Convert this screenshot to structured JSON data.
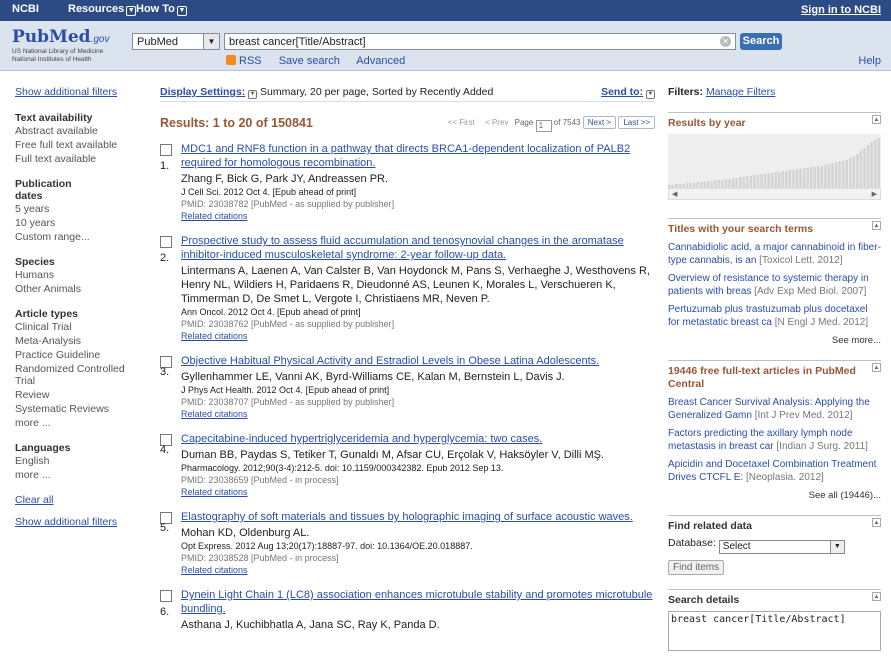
{
  "topbar": {
    "ncbi": "NCBI",
    "resources": "Resources",
    "howto": "How To",
    "signin": "Sign in to NCBI"
  },
  "logo": {
    "pub": "PubMed",
    "gov": ".gov",
    "nlm1": "US National Library of Medicine",
    "nlm2": "National Institutes of Health"
  },
  "search": {
    "db": "PubMed",
    "query": "breast cancer[Title/Abstract]",
    "button": "Search",
    "rss": "RSS",
    "save": "Save search",
    "advanced": "Advanced",
    "help": "Help"
  },
  "left": {
    "show_filters": "Show additional filters",
    "text_availability": "Text availability",
    "ta_items": [
      "Abstract available",
      "Free full text available",
      "Full text available"
    ],
    "pub_dates": "Publication dates",
    "pd_items": [
      "5 years",
      "10 years",
      "Custom range..."
    ],
    "species": "Species",
    "sp_items": [
      "Humans",
      "Other Animals"
    ],
    "article_types": "Article types",
    "at_items": [
      "Clinical Trial",
      "Meta-Analysis",
      "Practice Guideline",
      "Randomized Controlled Trial",
      "Review",
      "Systematic Reviews",
      "more ..."
    ],
    "languages": "Languages",
    "lang_items": [
      "English",
      "more ..."
    ],
    "clear_all": "Clear all",
    "show_filters2": "Show additional filters"
  },
  "display": {
    "label": "Display Settings:",
    "summary": "Summary, 20 per page, Sorted by Recently Added",
    "sendto": "Send to:"
  },
  "results": {
    "count": "Results: 1 to 20 of 150841",
    "pager": {
      "first": "<< First",
      "prev": "< Prev",
      "page_label": "Page",
      "page": "1",
      "of": "of 7543",
      "next": "Next >",
      "last": "Last >>"
    },
    "items": [
      {
        "num": "1.",
        "title": "MDC1 and RNF8 function in a pathway that directs BRCA1-dependent localization of PALB2 required for homologous recombination.",
        "authors": "Zhang F, Bick G, Park JY, Andreassen PR.",
        "journal": "J Cell Sci. 2012 Oct 4. [Epub ahead of print]",
        "pmid": "PMID: 23038782 [PubMed - as supplied by publisher]",
        "related": "Related citations"
      },
      {
        "num": "2.",
        "title": "Prospective study to assess fluid accumulation and tenosynovial changes in the aromatase inhibitor-induced musculoskeletal syndrome: 2-year follow-up data.",
        "authors": "Lintermans A, Laenen A, Van Calster B, Van Hoydonck M, Pans S, Verhaeghe J, Westhovens R, Henry NL, Wildiers H, Paridaens R, Dieudonné AS, Leunen K, Morales L, Verschueren K, Timmerman D, De Smet L, Vergote I, Christiaens MR, Neven P.",
        "journal": "Ann Oncol. 2012 Oct 4. [Epub ahead of print]",
        "pmid": "PMID: 23038762 [PubMed - as supplied by publisher]",
        "related": "Related citations"
      },
      {
        "num": "3.",
        "title": "Objective Habitual Physical Activity and Estradiol Levels in Obese Latina Adolescents.",
        "authors": "Gyllenhammer LE, Vanni AK, Byrd-Williams CE, Kalan M, Bernstein L, Davis J.",
        "journal": "J Phys Act Health. 2012 Oct 4. [Epub ahead of print]",
        "pmid": "PMID: 23038707 [PubMed - as supplied by publisher]",
        "related": "Related citations"
      },
      {
        "num": "4.",
        "title": "Capecitabine-induced hypertriglyceridemia and hyperglycemia: two cases.",
        "authors": "Duman BB, Paydas S, Tetiker T, Gunaldı M, Afsar CU, Erçolak V, Haksöyler V, Dilli MŞ.",
        "journal": "Pharmacology. 2012;90(3-4):212-5. doi: 10.1159/000342382. Epub 2012 Sep 13.",
        "pmid": "PMID: 23038659 [PubMed - in process]",
        "related": "Related citations"
      },
      {
        "num": "5.",
        "title": "Elastography of soft materials and tissues by holographic imaging of surface acoustic waves.",
        "authors": "Mohan KD, Oldenburg AL.",
        "journal": "Opt Express. 2012 Aug 13;20(17):18887-97. doi: 10.1364/OE.20.018887.",
        "pmid": "PMID: 23038528 [PubMed - in process]",
        "related": "Related citations"
      },
      {
        "num": "6.",
        "title": "Dynein Light Chain 1 (LC8) association enhances microtubule stability and promotes microtubule bundling.",
        "authors": "Asthana J, Kuchibhatla A, Jana SC, Ray K, Panda D.",
        "journal": "",
        "pmid": "",
        "related": ""
      }
    ]
  },
  "right": {
    "filters_label": "Filters:",
    "manage": "Manage Filters",
    "results_by_year": "Results by year",
    "year_bars": [
      3,
      3,
      4,
      4,
      4,
      5,
      5,
      5,
      6,
      6,
      6,
      7,
      7,
      8,
      8,
      8,
      9,
      9,
      10,
      10,
      11,
      11,
      12,
      12,
      13,
      13,
      14,
      14,
      15,
      15,
      16,
      16,
      17,
      17,
      18,
      18,
      19,
      19,
      20,
      20,
      21,
      21,
      22,
      22,
      23,
      24,
      25,
      26,
      26,
      27,
      28,
      30,
      32,
      34,
      37,
      40,
      43,
      46,
      48,
      50
    ],
    "titles_header": "Titles with your search terms",
    "titles": [
      {
        "text": "Cannabidiolic acid, a major cannabinoid in fiber-type cannabis, is an",
        "src": "[Toxicol Lett. 2012]"
      },
      {
        "text": "Overview of resistance to systemic therapy in patients with breas",
        "src": "[Adv Exp Med Biol. 2007]"
      },
      {
        "text": "Pertuzumab plus trastuzumab plus docetaxel for metastatic breast ca",
        "src": "[N Engl J Med. 2012]"
      }
    ],
    "see_more": "See more...",
    "free_header": "19446 free full-text articles in PubMed Central",
    "free": [
      {
        "text": "Breast Cancer Survival Analysis: Applying the Generalized Gamn",
        "src": "[Int J Prev Med. 2012]"
      },
      {
        "text": "Factors predicting the axillary lymph node metastasis in breast car",
        "src": "[Indian J Surg. 2011]"
      },
      {
        "text": "Apicidin and Docetaxel Combination Treatment Drives CTCFL E:",
        "src": "[Neoplasia. 2012]"
      }
    ],
    "see_all": "See all (19446)...",
    "related_header": "Find related data",
    "database_label": "Database:",
    "database_value": "Select",
    "find_items": "Find items",
    "details_header": "Search details",
    "details_value": "breast cancer[Title/Abstract]"
  }
}
